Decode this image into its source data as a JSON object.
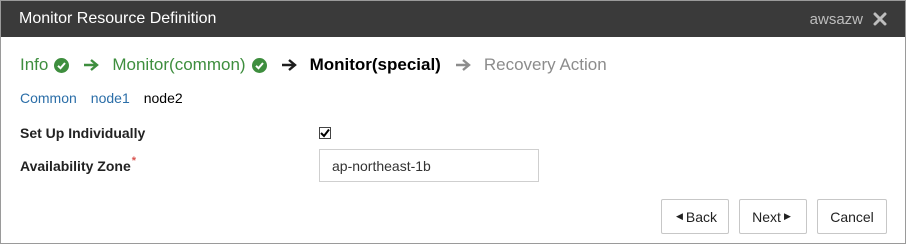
{
  "dialog": {
    "title": "Monitor Resource Definition",
    "resource_name": "awsazw",
    "close_icon": "close-icon"
  },
  "steps": [
    {
      "label": "Info",
      "state": "done"
    },
    {
      "label": "Monitor(common)",
      "state": "done"
    },
    {
      "label": "Monitor(special)",
      "state": "current"
    },
    {
      "label": "Recovery Action",
      "state": "pending"
    }
  ],
  "tabs": [
    {
      "label": "Common",
      "active": false
    },
    {
      "label": "node1",
      "active": false
    },
    {
      "label": "node2",
      "active": true
    }
  ],
  "form": {
    "setup_individually": {
      "label": "Set Up Individually",
      "checked": true
    },
    "availability_zone": {
      "label": "Availability Zone",
      "required_mark": "*",
      "value": "ap-northeast-1b"
    }
  },
  "buttons": {
    "back": "Back",
    "next": "Next",
    "cancel": "Cancel"
  },
  "colors": {
    "done": "#3e8e3e",
    "pending": "#8c8c8c",
    "link": "#2b6ea8",
    "titlebar": "#3a3a3a"
  }
}
